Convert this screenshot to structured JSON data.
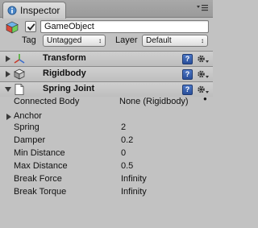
{
  "window": {
    "tab_label": "Inspector"
  },
  "header": {
    "object_name": "GameObject",
    "active": true,
    "tag_label": "Tag",
    "tag_value": "Untagged",
    "layer_label": "Layer",
    "layer_value": "Default"
  },
  "components": {
    "transform": {
      "title": "Transform",
      "expanded": false
    },
    "rigidbody": {
      "title": "Rigidbody",
      "expanded": false
    },
    "spring_joint": {
      "title": "Spring Joint",
      "expanded": true
    }
  },
  "spring_joint": {
    "connected_body": {
      "label": "Connected Body",
      "value": "None (Rigidbody)"
    },
    "anchor": {
      "label": "Anchor"
    },
    "spring": {
      "label": "Spring",
      "value": "2"
    },
    "damper": {
      "label": "Damper",
      "value": "0.2"
    },
    "min_distance": {
      "label": "Min Distance",
      "value": "0"
    },
    "max_distance": {
      "label": "Max Distance",
      "value": "0.5"
    },
    "break_force": {
      "label": "Break Force",
      "value": "Infinity"
    },
    "break_torque": {
      "label": "Break Torque",
      "value": "Infinity"
    }
  },
  "colors": {
    "panel_bg": "#c2c2c2",
    "help_icon": "#2a4f9a"
  },
  "icons": {
    "tab": "inspector-icon",
    "object": "cube-icon",
    "transform": "transform-axes-icon",
    "rigidbody": "rigidbody-icon",
    "spring_joint": "document-icon",
    "help": "help-book-icon",
    "settings": "gear-icon"
  }
}
